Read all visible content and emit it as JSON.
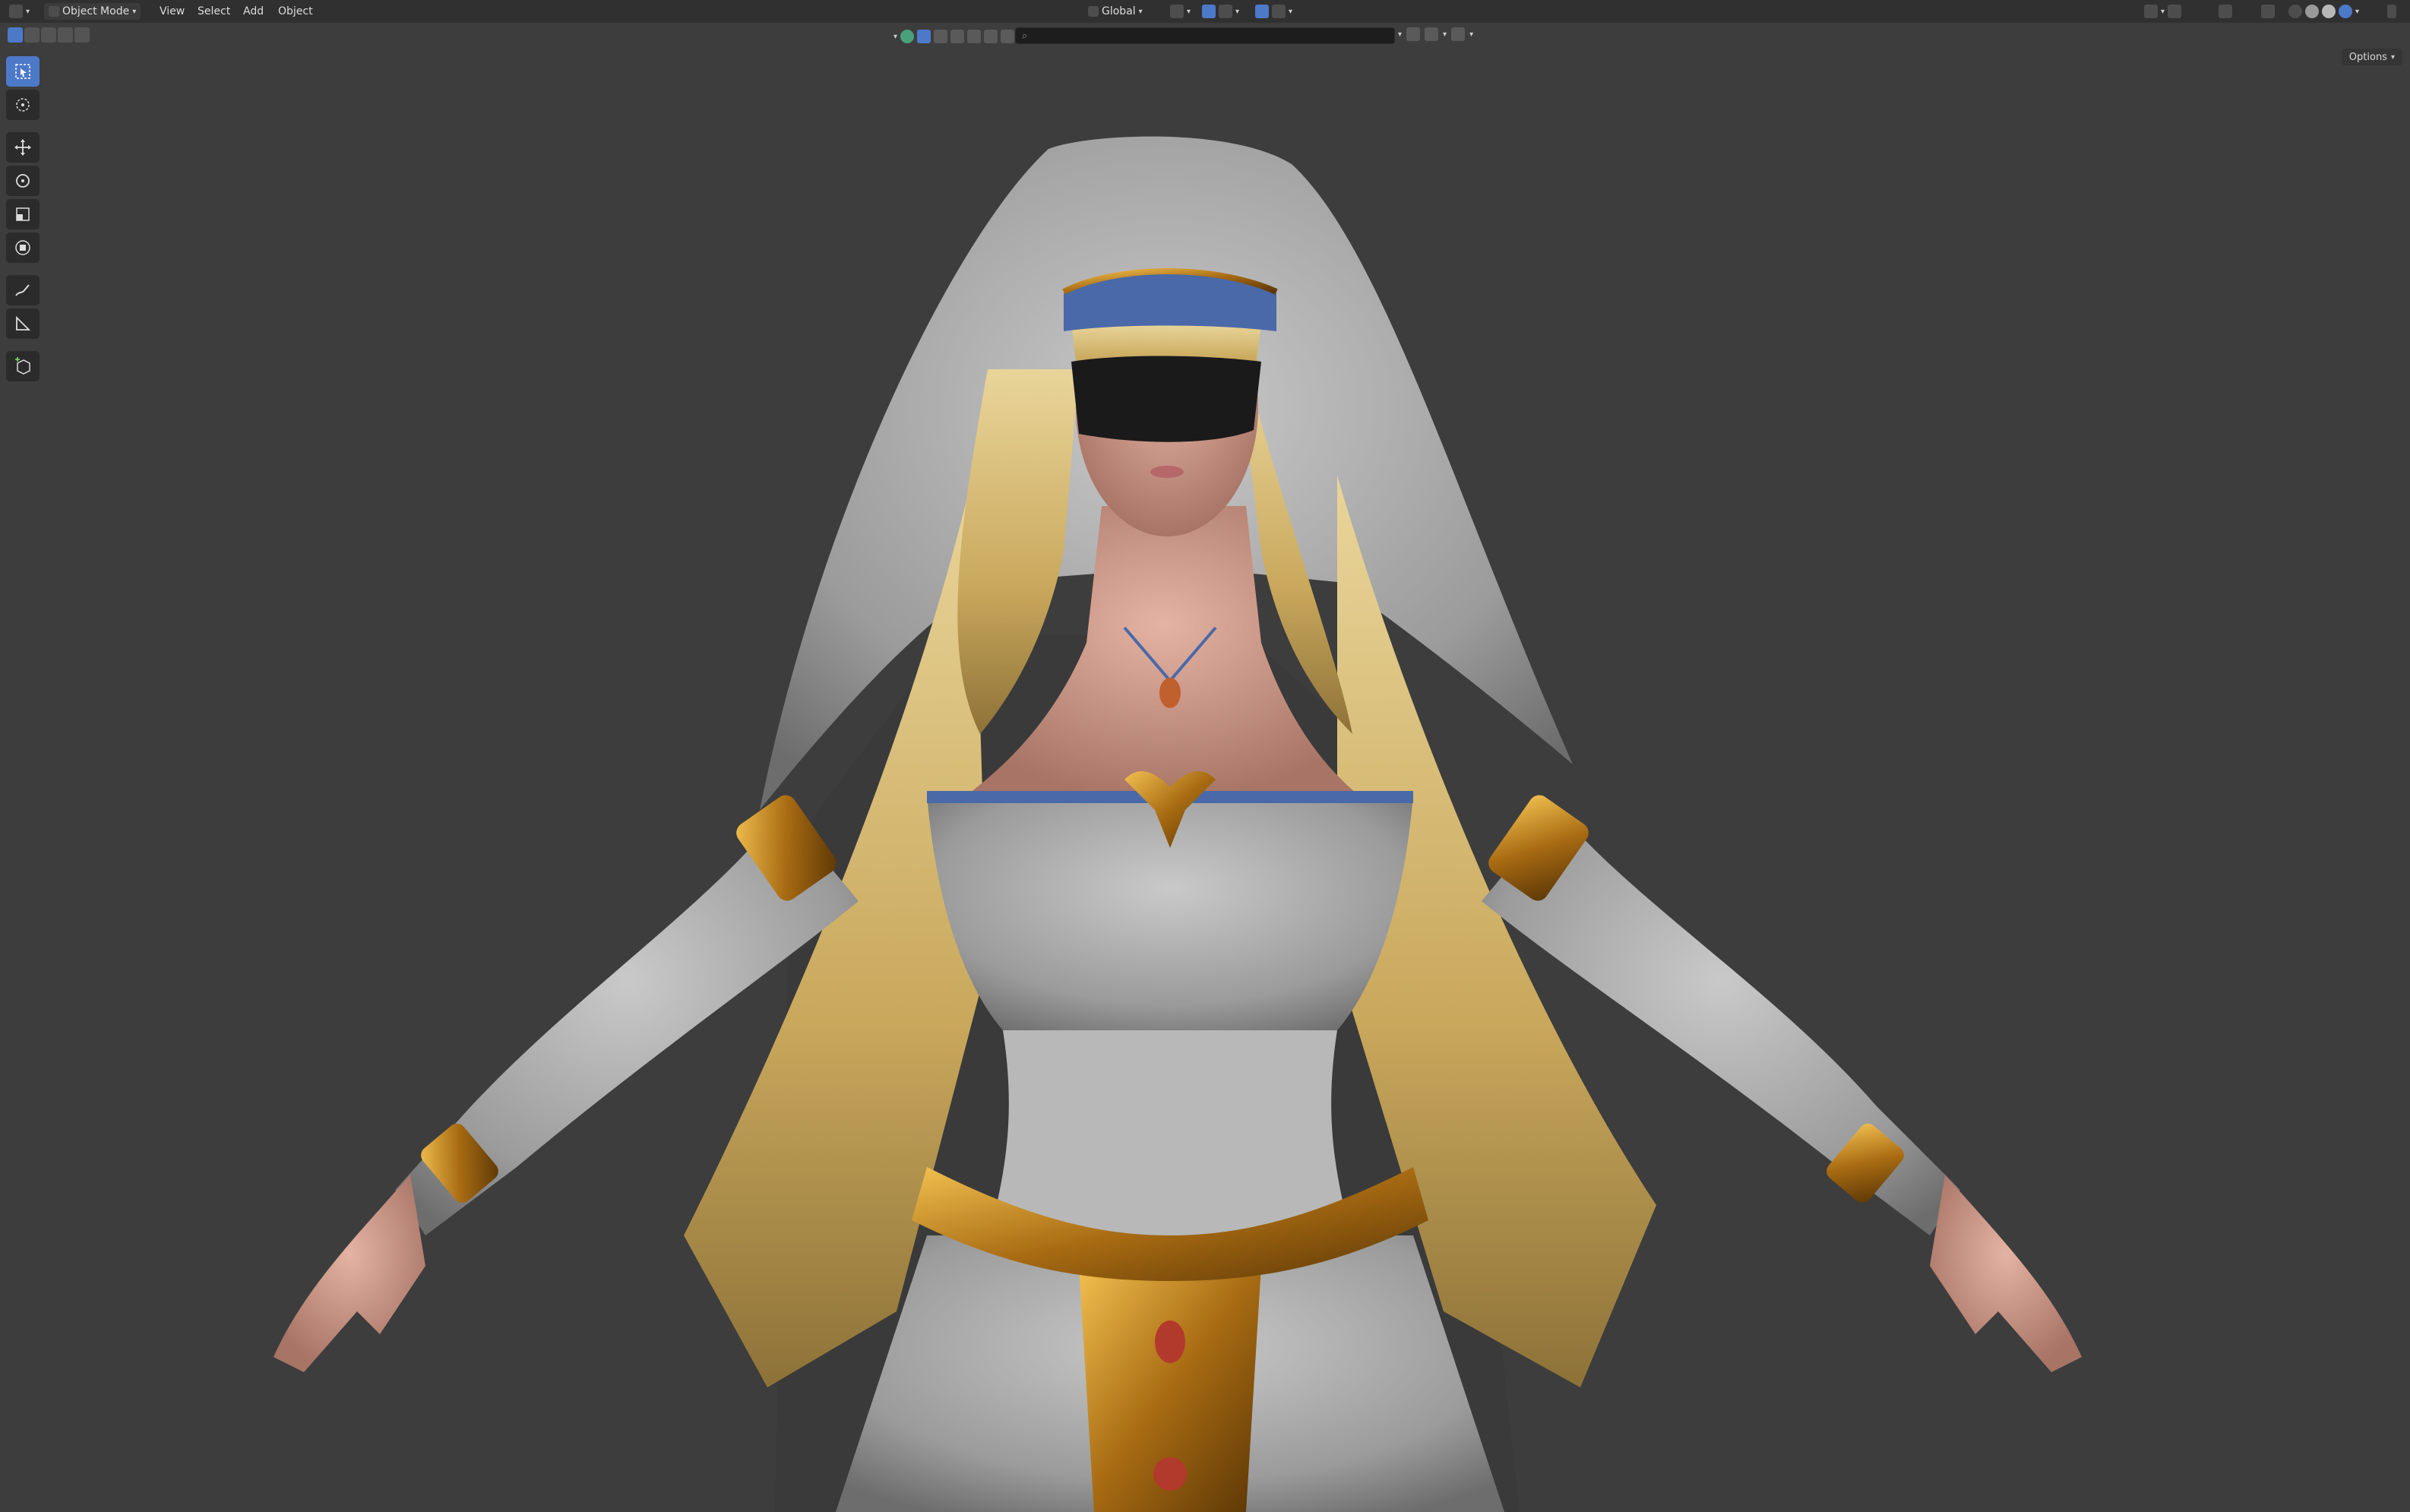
{
  "header": {
    "mode_label": "Object Mode",
    "menus": [
      "View",
      "Select",
      "Add",
      "Object"
    ],
    "transform_orientation": "Global",
    "options_label": "Options"
  },
  "toolbar": {
    "tools": [
      "select-box",
      "cursor",
      "move",
      "rotate",
      "scale",
      "transform",
      "annotate",
      "measure",
      "add-cube"
    ],
    "active_tool": "select-box"
  },
  "viewport": {
    "background_color": "#3d3d3d",
    "accent_color": "#4d79c9"
  },
  "outliner_search": {
    "placeholder": ""
  }
}
